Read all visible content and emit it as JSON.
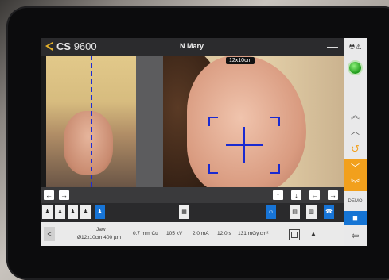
{
  "app": {
    "brand_bold": "CS",
    "brand_model": "9600",
    "patient": "N Mary"
  },
  "view": {
    "field_size": "12x10cm"
  },
  "status": {
    "collimation_label": "Jaw",
    "collimation_value": "Ø12x10cm 400 µm",
    "filter": "0.7 mm Cu",
    "voltage": "105 kV",
    "current": "2.0 mA",
    "time": "12.0 s",
    "dose": "131 mGy.cm²"
  },
  "right_panel": {
    "demo_label": "DEMO"
  },
  "colors": {
    "accent_blue": "#1574d4",
    "accent_orange": "#f2a01c",
    "ready_green": "#2eb82a",
    "target_blue": "#1a2ad0"
  }
}
